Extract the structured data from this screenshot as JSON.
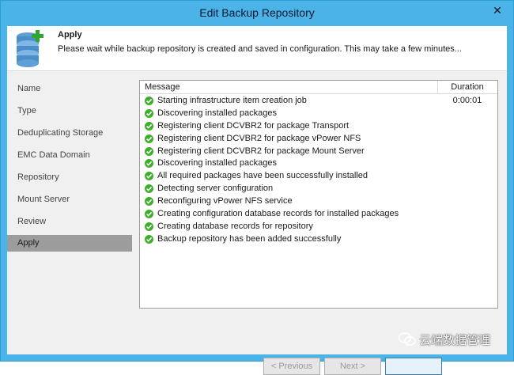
{
  "window": {
    "title": "Edit Backup Repository",
    "close_glyph": "✕"
  },
  "header": {
    "title": "Apply",
    "description": "Please wait while backup repository is created and saved in configuration. This may take a few minutes...",
    "icon": "database-add-icon"
  },
  "nav": {
    "items": [
      {
        "label": "Name"
      },
      {
        "label": "Type"
      },
      {
        "label": "Deduplicating Storage"
      },
      {
        "label": "EMC Data Domain"
      },
      {
        "label": "Repository"
      },
      {
        "label": "Mount Server"
      },
      {
        "label": "Review"
      },
      {
        "label": "Apply",
        "active": true
      }
    ]
  },
  "log": {
    "columns": {
      "message": "Message",
      "duration": "Duration"
    },
    "rows": [
      {
        "message": "Starting infrastructure item creation job",
        "duration": "0:00:01",
        "status": "success"
      },
      {
        "message": "Discovering installed packages",
        "duration": "",
        "status": "success"
      },
      {
        "message": "Registering client DCVBR2 for package Transport",
        "duration": "",
        "status": "success"
      },
      {
        "message": "Registering client DCVBR2 for package vPower NFS",
        "duration": "",
        "status": "success"
      },
      {
        "message": "Registering client DCVBR2 for package Mount Server",
        "duration": "",
        "status": "success"
      },
      {
        "message": "Discovering installed packages",
        "duration": "",
        "status": "success"
      },
      {
        "message": "All required packages have been successfully installed",
        "duration": "",
        "status": "success"
      },
      {
        "message": "Detecting server configuration",
        "duration": "",
        "status": "success"
      },
      {
        "message": "Reconfiguring vPower NFS service",
        "duration": "",
        "status": "success"
      },
      {
        "message": "Creating configuration database records for installed packages",
        "duration": "",
        "status": "success"
      },
      {
        "message": "Creating database records for repository",
        "duration": "",
        "status": "success"
      },
      {
        "message": "Backup repository has been added successfully",
        "duration": "",
        "status": "success"
      }
    ]
  },
  "buttons": {
    "previous": "< Previous",
    "next": "Next >",
    "finish": ""
  },
  "watermark": {
    "text": "云端数据管理"
  },
  "colors": {
    "titlebar": "#4cb3e9",
    "success": "#3fae2a",
    "nav_active": "#9c9c9c"
  }
}
